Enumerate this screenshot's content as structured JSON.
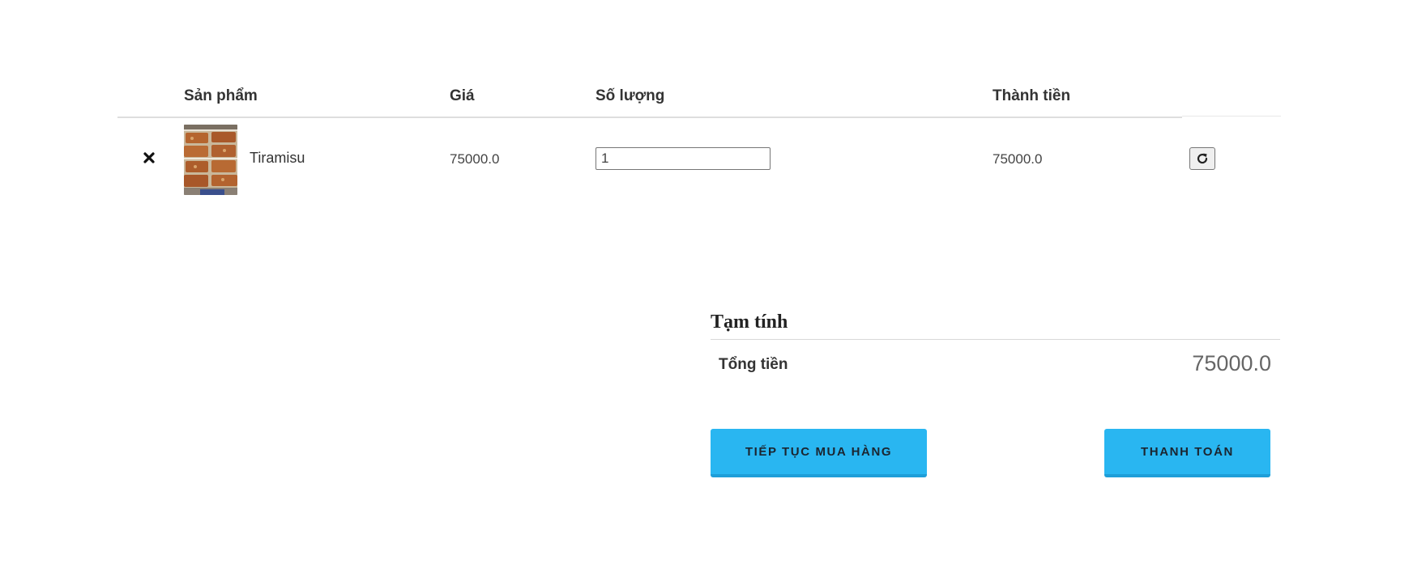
{
  "cart": {
    "headers": {
      "product": "Sản phẩm",
      "price": "Giá",
      "quantity": "Số lượng",
      "total": "Thành tiền"
    },
    "items": [
      {
        "remove_icon": "close-icon",
        "thumbnail_icon": "product-thumbnail",
        "name": "Tiramisu",
        "price": "75000.0",
        "quantity": "1",
        "total": "75000.0",
        "update_icon": "refresh-icon"
      }
    ]
  },
  "totals": {
    "title": "Tạm tính",
    "label": "Tổng tiền",
    "value": "75000.0"
  },
  "actions": {
    "continue_label": "TIẾP TỤC MUA HÀNG",
    "checkout_label": "THANH TOÁN"
  },
  "colors": {
    "primary_button": "#29b6f1",
    "primary_button_border": "#1e9ed8"
  }
}
